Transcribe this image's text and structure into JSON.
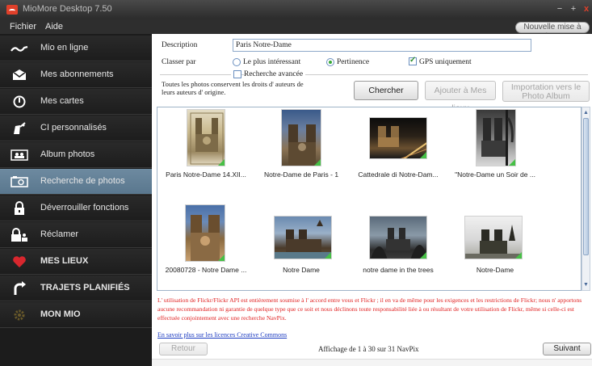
{
  "window": {
    "title": "MioMore Desktop 7.50",
    "min_glyph": "−",
    "max_glyph": "+",
    "close_glyph": "x"
  },
  "menu": {
    "fichier": "Fichier",
    "aide": "Aide",
    "update_button": "Nouvelle mise à jour"
  },
  "sidebar": {
    "items": [
      {
        "label": "Mio en ligne",
        "icon": "signal-wave-icon"
      },
      {
        "label": "Mes abonnements",
        "icon": "envelope-icon"
      },
      {
        "label": "Mes cartes",
        "icon": "power-circle-icon"
      },
      {
        "label": "CI personnalisés",
        "icon": "thumbs-pin-icon"
      },
      {
        "label": "Album photos",
        "icon": "photo-album-icon"
      },
      {
        "label": "Recherche de photos",
        "icon": "camera-icon",
        "active": true
      },
      {
        "label": "Déverrouiller fonctions",
        "icon": "padlock-icon"
      },
      {
        "label": "Réclamer",
        "icon": "lock-people-icon"
      },
      {
        "label": "MES LIEUX",
        "icon": "heart-icon"
      },
      {
        "label": "TRAJETS PLANIFIÉS",
        "icon": "route-arrow-icon"
      },
      {
        "label": "MON MIO",
        "icon": "gear-icon"
      }
    ]
  },
  "form": {
    "description_label": "Description",
    "description_value": "Paris Notre-Dame",
    "sort_label": "Classer par",
    "radio_interesting": "Le plus intéressant",
    "radio_relevance": "Pertinence",
    "gps_label": "GPS uniquement",
    "advanced_label": "Recherche avancée",
    "rights_note": "Toutes les photos conservent les droits d' auteurs de leurs auteurs d' origine.",
    "search_button": "Chercher",
    "add_button": "Ajouter à Mes lieux",
    "import_button": "Importation vers le Photo Album"
  },
  "results": [
    {
      "caption": "Paris Notre-Dame 14.XII...",
      "colors": [
        "#c9b98e",
        "#8b7a55",
        "#e8dfc6"
      ]
    },
    {
      "caption": "Notre-Dame de Paris - 1",
      "colors": [
        "#3a5a8a",
        "#a08a6a",
        "#d9c7a8"
      ]
    },
    {
      "caption": "Cattedrale di Notre-Dam...",
      "colors": [
        "#1a1a1a",
        "#5a4a3a",
        "#c8a060"
      ]
    },
    {
      "caption": "\"Notre-Dame un Soir de ...",
      "colors": [
        "#4a4a4a",
        "#8a8a8a",
        "#d0d0d0"
      ]
    },
    {
      "caption": "20080728 - Notre Dame ...",
      "colors": [
        "#5a7aa8",
        "#8a6a40",
        "#c8a070"
      ]
    },
    {
      "caption": "Notre Dame",
      "colors": [
        "#6a8ab0",
        "#4a3a2a",
        "#b09070"
      ]
    },
    {
      "caption": "notre dame in the trees",
      "colors": [
        "#7a8a9a",
        "#3a3a3a",
        "#8a9aa8"
      ]
    },
    {
      "caption": "Notre-Dame",
      "colors": [
        "#e8e8e8",
        "#3a3a30",
        "#a8a8a0"
      ]
    }
  ],
  "disclaimer": "L' utilisation de Flickr/Flickr API est entièrement soumise à l' accord entre vous et Flickr ; il en va de même pour les exigences et les restrictions de Flickr; nous n' apportons aucune recommandation ni garantie de quelque type que ce soit et nous déclinons toute responsabilité liée à ou résultant de votre utilisation de Flickr, même si celle-ci est effectuée conjointement avec une recherche NavPix.",
  "cc_link": "En savoir plus sur les licences Creative Commons",
  "pager": {
    "back_button": "Retour",
    "status": "Affichage de 1 à 30 sur 31 NavPix",
    "next_button": "Suivant"
  },
  "colors": {
    "sidebar_bg": "#1c1c1c",
    "active_item": "#5f7c93",
    "disclaimer": "#e02020",
    "link": "#1a3ac0"
  }
}
